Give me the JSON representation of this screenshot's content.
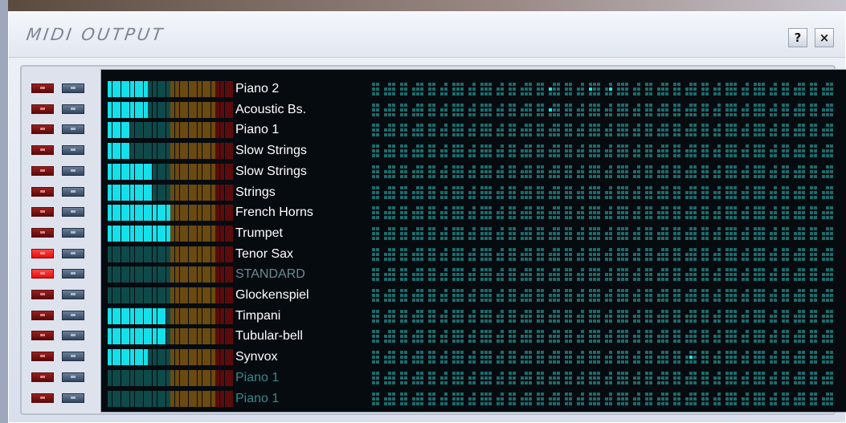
{
  "window": {
    "title": "MIDI OUTPUT",
    "help_label": "?",
    "close_label": "×"
  },
  "colors": {
    "meter_on": "#15e0ea",
    "meter_off": "#0f4a4a",
    "meter_mid_off": "#6a4a10",
    "meter_high_off": "#5a0c0c",
    "pattern_cell": "#1c6b6b",
    "pattern_hit": "#15e8ef"
  },
  "channels": [
    {
      "name": "Piano 2",
      "level": 9,
      "muted": false,
      "name_style": "on",
      "hits": [
        31,
        38,
        42
      ]
    },
    {
      "name": "Acoustic Bs.",
      "level": 9,
      "muted": false,
      "name_style": "on",
      "hits": [
        31
      ]
    },
    {
      "name": "Piano 1",
      "level": 5,
      "muted": false,
      "name_style": "on",
      "hits": []
    },
    {
      "name": "Slow Strings",
      "level": 5,
      "muted": false,
      "name_style": "on",
      "hits": []
    },
    {
      "name": "Slow Strings",
      "level": 10,
      "muted": false,
      "name_style": "on",
      "hits": []
    },
    {
      "name": "Strings",
      "level": 10,
      "muted": false,
      "name_style": "on",
      "hits": []
    },
    {
      "name": "French Horns",
      "level": 14,
      "muted": false,
      "name_style": "on",
      "hits": []
    },
    {
      "name": "Trumpet",
      "level": 14,
      "muted": false,
      "name_style": "on",
      "hits": []
    },
    {
      "name": "Tenor Sax",
      "level": 0,
      "muted": true,
      "name_style": "on",
      "hits": []
    },
    {
      "name": "STANDARD",
      "level": 0,
      "muted": true,
      "name_style": "mid",
      "hits": []
    },
    {
      "name": "Glockenspiel",
      "level": 0,
      "muted": false,
      "name_style": "on",
      "hits": []
    },
    {
      "name": "Timpani",
      "level": 13,
      "muted": false,
      "name_style": "on",
      "hits": []
    },
    {
      "name": "Tubular-bell",
      "level": 13,
      "muted": false,
      "name_style": "on",
      "hits": []
    },
    {
      "name": "Synvox",
      "level": 9,
      "muted": false,
      "name_style": "on",
      "hits": [
        56
      ]
    },
    {
      "name": "Piano 1",
      "level": 0,
      "muted": false,
      "name_style": "off",
      "hits": []
    },
    {
      "name": "Piano 1",
      "level": 0,
      "muted": false,
      "name_style": "off",
      "hits": []
    }
  ]
}
